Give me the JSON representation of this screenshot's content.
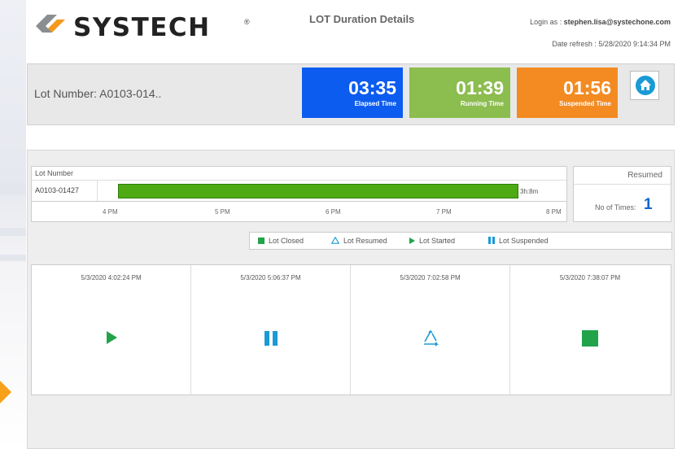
{
  "header": {
    "brand": "SYSTECH",
    "registered_mark": "®",
    "title": "LOT Duration Details",
    "login_prefix": "Login as : ",
    "login_user": "stephen.lisa@systechone.com",
    "date_refresh": "Date refresh : 5/28/2020 9:14:34 PM"
  },
  "lot": {
    "label": "Lot Number: A0103-014..",
    "tiles": [
      {
        "value": "03:35",
        "label": "Elapsed Time",
        "color": "#0d5cf0"
      },
      {
        "value": "01:39",
        "label": "Running Time",
        "color": "#8cbd4f"
      },
      {
        "value": "01:56",
        "label": "Suspended Time",
        "color": "#f38b22"
      }
    ],
    "home_icon": "home-icon"
  },
  "gantt": {
    "header": "Lot Number",
    "row_label": "A0103-01427",
    "duration": "3h:8m",
    "bar_color": "#4eaa13",
    "ticks": [
      "4 PM",
      "5 PM",
      "6 PM",
      "7 PM",
      "8 PM"
    ]
  },
  "resumed": {
    "title": "Resumed",
    "count_label": "No of Times:",
    "count": "1"
  },
  "legend": [
    {
      "label": "Lot Closed",
      "icon": "square-icon",
      "color": "#22a34a"
    },
    {
      "label": "Lot Resumed",
      "icon": "recycle-icon",
      "color": "#1a9ad6"
    },
    {
      "label": "Lot Started",
      "icon": "play-icon",
      "color": "#22a34a"
    },
    {
      "label": "Lot Suspended",
      "icon": "pause-icon",
      "color": "#1a9ad6"
    }
  ],
  "events": [
    {
      "time": "5/3/2020 4:02:24 PM",
      "icon": "play-icon",
      "color": "#22a34a"
    },
    {
      "time": "5/3/2020 5:06:37 PM",
      "icon": "pause-icon",
      "color": "#1a9ad6"
    },
    {
      "time": "5/3/2020 7:02:58 PM",
      "icon": "recycle-icon",
      "color": "#1a9ad6"
    },
    {
      "time": "5/3/2020 7:38:07 PM",
      "icon": "square-icon",
      "color": "#22a34a"
    }
  ]
}
